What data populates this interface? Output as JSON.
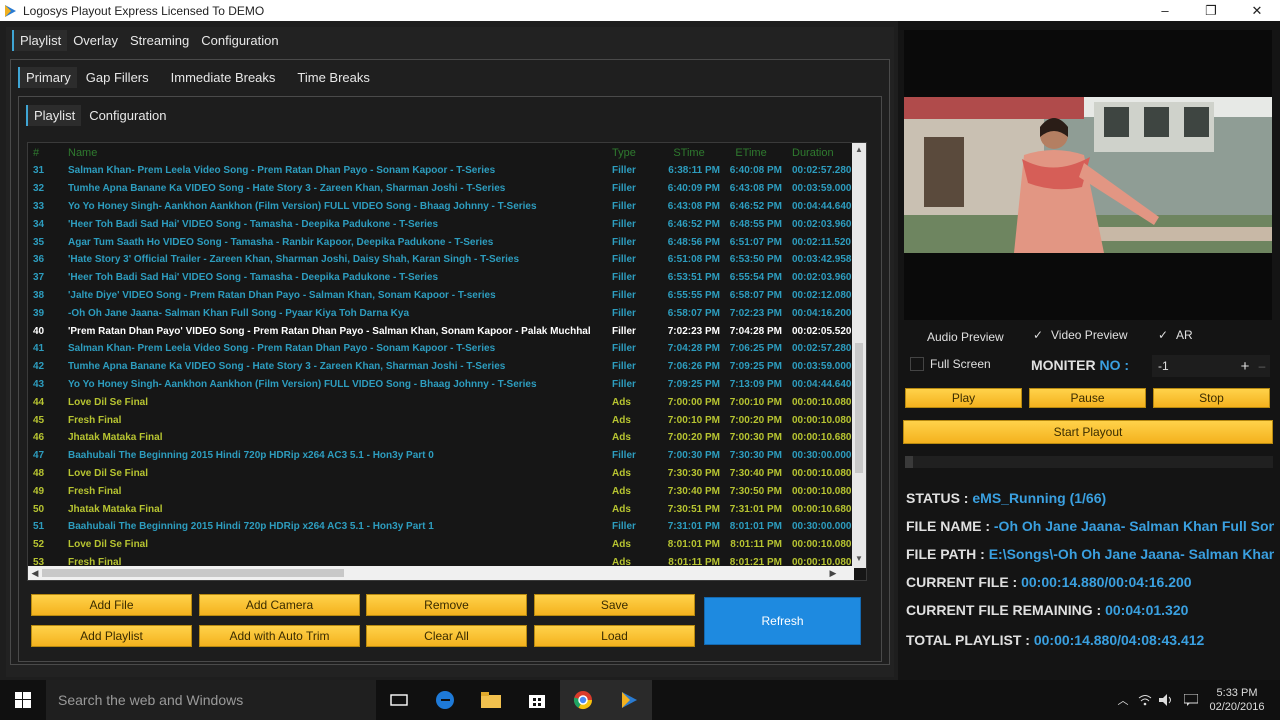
{
  "window": {
    "title": "Logosys Playout Express Licensed To DEMO",
    "min": "–",
    "max": "❐",
    "close": "✕"
  },
  "main_tabs": [
    "Playlist",
    "Overlay",
    "Streaming",
    "Configuration"
  ],
  "sub_tabs": [
    "Primary",
    "Gap Fillers",
    "Immediate Breaks",
    "Time Breaks"
  ],
  "inner_tabs": [
    "Playlist",
    "Configuration"
  ],
  "playlist": {
    "columns": [
      "#",
      "Name",
      "Type",
      "STime",
      "ETime",
      "Duration"
    ],
    "rows": [
      {
        "n": "31",
        "name": "Salman Khan- Prem Leela Video Song - Prem Ratan Dhan Payo - Sonam Kapoor - T-Series",
        "type": "Filler",
        "st": "6:38:11 PM",
        "et": "6:40:08 PM",
        "du": "00:02:57.280"
      },
      {
        "n": "32",
        "name": "Tumhe Apna Banane Ka VIDEO Song - Hate Story 3 - Zareen Khan, Sharman Joshi - T-Series",
        "type": "Filler",
        "st": "6:40:09 PM",
        "et": "6:43:08 PM",
        "du": "00:03:59.000"
      },
      {
        "n": "33",
        "name": "Yo Yo Honey Singh- Aankhon Aankhon (Film Version) FULL VIDEO Song - Bhaag Johnny - T-Series",
        "type": "Filler",
        "st": "6:43:08 PM",
        "et": "6:46:52 PM",
        "du": "00:04:44.640"
      },
      {
        "n": "34",
        "name": "'Heer Toh Badi Sad Hai' VIDEO Song - Tamasha - Deepika Padukone - T-Series",
        "type": "Filler",
        "st": "6:46:52 PM",
        "et": "6:48:55 PM",
        "du": "00:02:03.960"
      },
      {
        "n": "35",
        "name": "Agar Tum Saath Ho VIDEO Song - Tamasha - Ranbir Kapoor, Deepika Padukone - T-Series",
        "type": "Filler",
        "st": "6:48:56 PM",
        "et": "6:51:07 PM",
        "du": "00:02:11.520"
      },
      {
        "n": "36",
        "name": "'Hate Story 3' Official Trailer - Zareen Khan, Sharman Joshi, Daisy Shah, Karan Singh - T-Series",
        "type": "Filler",
        "st": "6:51:08 PM",
        "et": "6:53:50 PM",
        "du": "00:03:42.958"
      },
      {
        "n": "37",
        "name": "'Heer Toh Badi Sad Hai' VIDEO Song - Tamasha - Deepika Padukone - T-Series",
        "type": "Filler",
        "st": "6:53:51 PM",
        "et": "6:55:54 PM",
        "du": "00:02:03.960"
      },
      {
        "n": "38",
        "name": "'Jalte Diye' VIDEO Song - Prem Ratan Dhan Payo - Salman Khan, Sonam Kapoor - T-series",
        "type": "Filler",
        "st": "6:55:55 PM",
        "et": "6:58:07 PM",
        "du": "00:02:12.080"
      },
      {
        "n": "39",
        "name": "-Oh Oh Jane Jaana- Salman Khan Full Song - Pyaar Kiya Toh Darna Kya",
        "type": "Filler",
        "st": "6:58:07 PM",
        "et": "7:02:23 PM",
        "du": "00:04:16.200"
      },
      {
        "n": "40",
        "name": "'Prem Ratan Dhan Payo' VIDEO Song - Prem Ratan Dhan Payo - Salman Khan, Sonam Kapoor - Palak Muchhal",
        "type": "Filler",
        "st": "7:02:23 PM",
        "et": "7:04:28 PM",
        "du": "00:02:05.520",
        "current": true
      },
      {
        "n": "41",
        "name": "Salman Khan- Prem Leela Video Song - Prem Ratan Dhan Payo - Sonam Kapoor - T-Series",
        "type": "Filler",
        "st": "7:04:28 PM",
        "et": "7:06:25 PM",
        "du": "00:02:57.280"
      },
      {
        "n": "42",
        "name": "Tumhe Apna Banane Ka VIDEO Song - Hate Story 3 - Zareen Khan, Sharman Joshi - T-Series",
        "type": "Filler",
        "st": "7:06:26 PM",
        "et": "7:09:25 PM",
        "du": "00:03:59.000"
      },
      {
        "n": "43",
        "name": "Yo Yo Honey Singh- Aankhon Aankhon (Film Version) FULL VIDEO Song - Bhaag Johnny - T-Series",
        "type": "Filler",
        "st": "7:09:25 PM",
        "et": "7:13:09 PM",
        "du": "00:04:44.640"
      },
      {
        "n": "44",
        "name": "Love Dil Se Final",
        "type": "Ads",
        "st": "7:00:00 PM",
        "et": "7:00:10 PM",
        "du": "00:00:10.080"
      },
      {
        "n": "45",
        "name": "Fresh Final",
        "type": "Ads",
        "st": "7:00:10 PM",
        "et": "7:00:20 PM",
        "du": "00:00:10.080"
      },
      {
        "n": "46",
        "name": "Jhatak Mataka Final",
        "type": "Ads",
        "st": "7:00:20 PM",
        "et": "7:00:30 PM",
        "du": "00:00:10.680"
      },
      {
        "n": "47",
        "name": "Baahubali The Beginning 2015 Hindi 720p HDRip x264 AC3 5.1 - Hon3y Part 0",
        "type": "Filler",
        "st": "7:00:30 PM",
        "et": "7:30:30 PM",
        "du": "00:30:00.000"
      },
      {
        "n": "48",
        "name": "Love Dil Se Final",
        "type": "Ads",
        "st": "7:30:30 PM",
        "et": "7:30:40 PM",
        "du": "00:00:10.080"
      },
      {
        "n": "49",
        "name": "Fresh Final",
        "type": "Ads",
        "st": "7:30:40 PM",
        "et": "7:30:50 PM",
        "du": "00:00:10.080"
      },
      {
        "n": "50",
        "name": "Jhatak Mataka Final",
        "type": "Ads",
        "st": "7:30:51 PM",
        "et": "7:31:01 PM",
        "du": "00:00:10.680"
      },
      {
        "n": "51",
        "name": "Baahubali The Beginning 2015 Hindi 720p HDRip x264 AC3 5.1 - Hon3y Part 1",
        "type": "Filler",
        "st": "7:31:01 PM",
        "et": "8:01:01 PM",
        "du": "00:30:00.000"
      },
      {
        "n": "52",
        "name": "Love Dil Se Final",
        "type": "Ads",
        "st": "8:01:01 PM",
        "et": "8:01:11 PM",
        "du": "00:00:10.080"
      },
      {
        "n": "53",
        "name": "Fresh Final",
        "type": "Ads",
        "st": "8:01:11 PM",
        "et": "8:01:21 PM",
        "du": "00:00:10.080"
      }
    ]
  },
  "buttons": {
    "add_file": "Add File",
    "add_camera": "Add Camera",
    "remove": "Remove",
    "save": "Save",
    "add_playlist": "Add Playlist",
    "add_auto_trim": "Add with Auto Trim",
    "clear_all": "Clear All",
    "load": "Load",
    "refresh": "Refresh"
  },
  "preview_options": {
    "audio_preview": "Audio Preview",
    "video_preview": "Video Preview",
    "ar": "AR",
    "full_screen": "Full Screen",
    "moniter_label": "MONITER",
    "no_label": "NO :",
    "moniter_value": "-1",
    "plus": "+",
    "minus": "–"
  },
  "controls": {
    "play": "Play",
    "pause": "Pause",
    "stop": "Stop",
    "start_playout": "Start Playout"
  },
  "status": {
    "status_label": "STATUS :",
    "status_value": "eMS_Running (1/66)",
    "file_name_label": "FILE NAME :",
    "file_name_value": "-Oh Oh Jane Jaana- Salman Khan Full Song",
    "file_path_label": "FILE PATH :",
    "file_path_value": "E:\\Songs\\-Oh Oh Jane Jaana- Salman Khan",
    "current_file_label": "CURRENT FILE :",
    "current_file_value": "00:00:14.880/00:04:16.200",
    "remaining_label": "CURRENT FILE REMAINING :",
    "remaining_value": "00:04:01.320",
    "total_label": "TOTAL PLAYLIST :",
    "total_value": "00:00:14.880/04:08:43.412"
  },
  "taskbar": {
    "search_placeholder": "Search the web and Windows",
    "time": "5:33 PM",
    "date": "02/20/2016"
  },
  "colors": {
    "filler": "#2d9dbf",
    "ads": "#b7c431",
    "accent": "#f4b21e",
    "refresh": "#1e8ae0",
    "status_value": "#3aa0e0"
  }
}
